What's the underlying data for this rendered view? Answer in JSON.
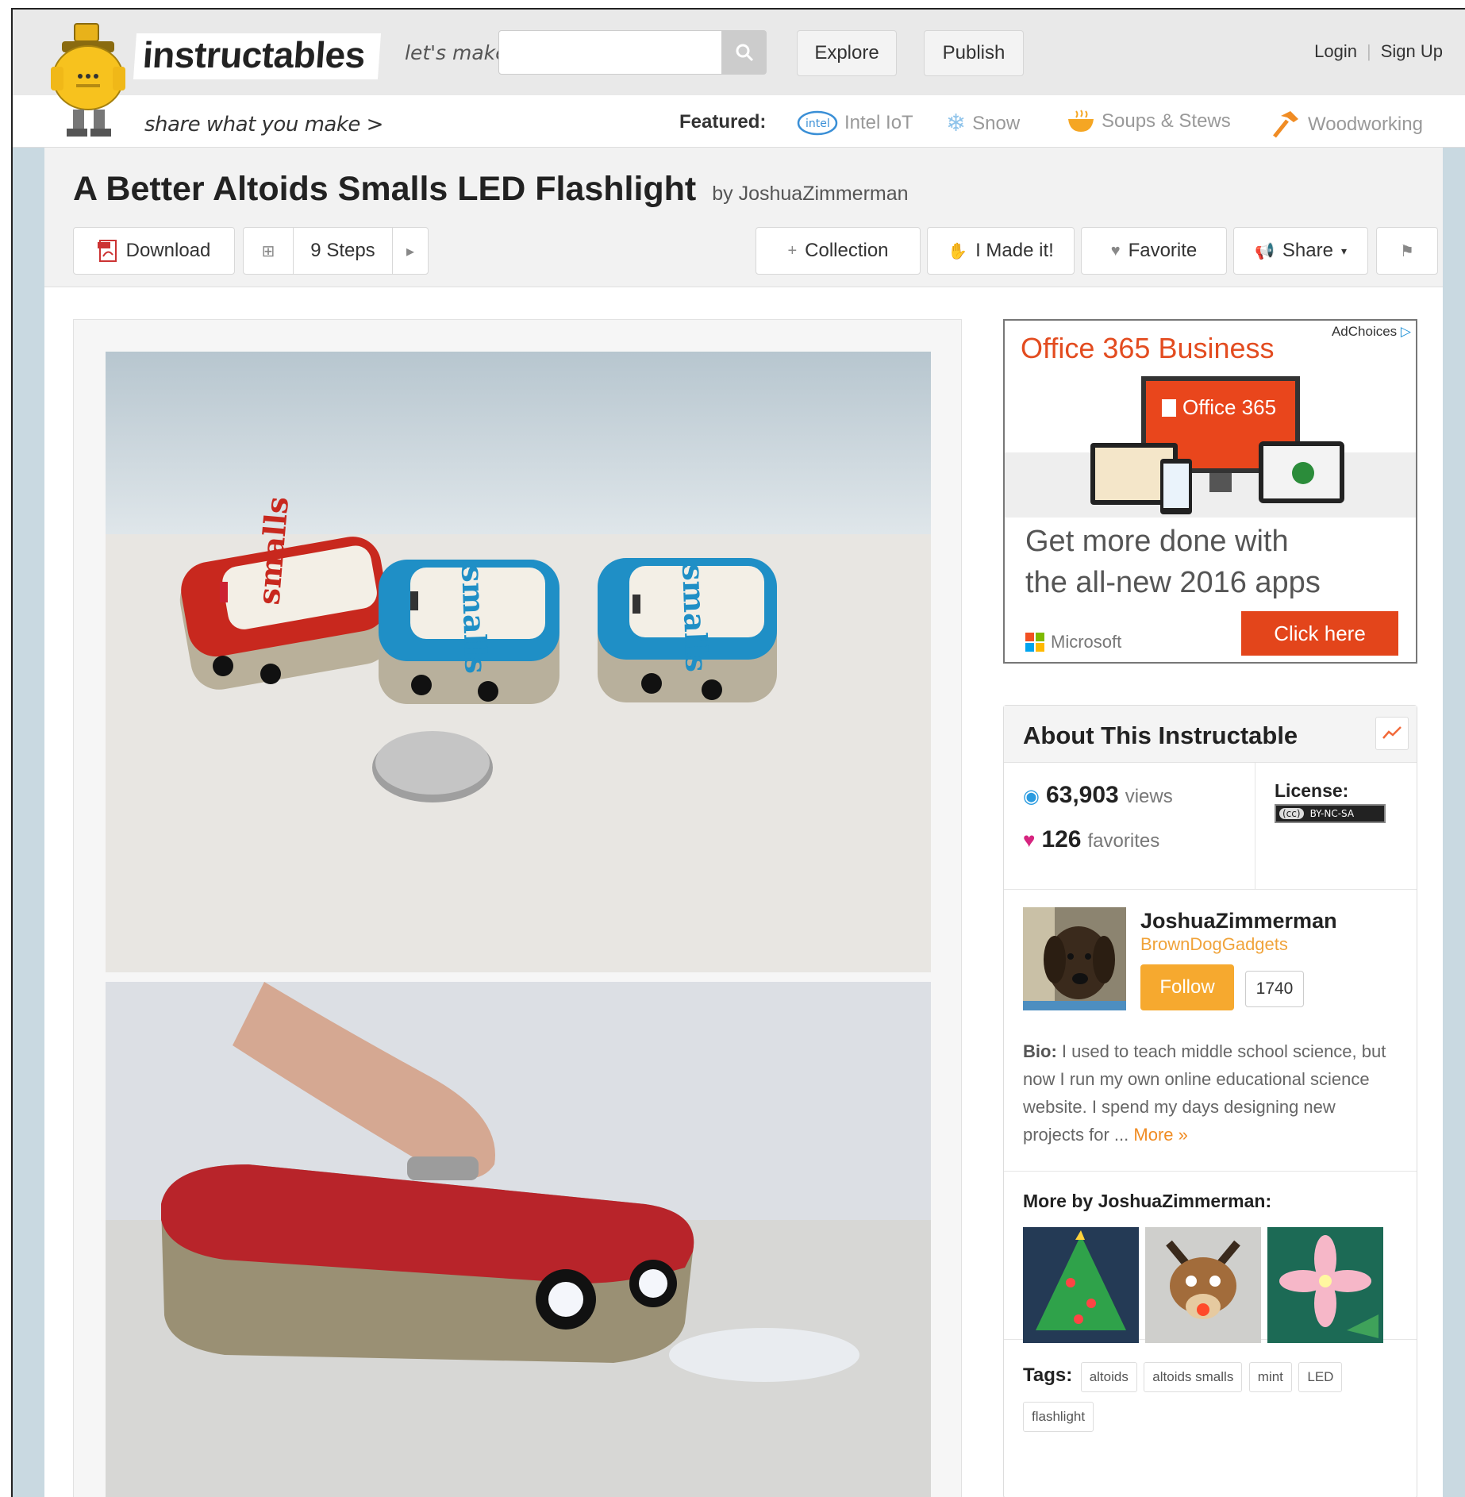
{
  "header": {
    "logo_text": "instructables",
    "tagline": "share what you make >",
    "lets_make_label": "let's make",
    "search_placeholder": "",
    "nav": {
      "explore": "Explore",
      "publish": "Publish",
      "login": "Login",
      "signup": "Sign Up",
      "separator": "|"
    },
    "featured": {
      "label": "Featured:",
      "items": [
        {
          "label": "Intel IoT",
          "icon": "intel-logo-icon"
        },
        {
          "label": "Snow",
          "icon": "snowflake-icon"
        },
        {
          "label": "Soups & Stews",
          "icon": "soup-bowl-icon"
        },
        {
          "label": "Woodworking",
          "icon": "hammer-icon"
        }
      ]
    }
  },
  "project": {
    "title": "A Better Altoids Smalls LED Flashlight",
    "by_prefix": "by",
    "author": "JoshuaZimmerman",
    "toolbar": {
      "download": "Download",
      "steps": "9 Steps",
      "collection": "Collection",
      "made_it": "I Made it!",
      "favorite": "Favorite",
      "share": "Share"
    }
  },
  "ad": {
    "title": "Office 365 Business",
    "adchoices": "AdChoices",
    "product_badge": "Office 365",
    "copy_line1": "Get more done with",
    "copy_line2": "the all-new 2016 apps",
    "brand": "Microsoft",
    "cta": "Click here"
  },
  "about": {
    "title": "About This Instructable",
    "views_count": "63,903",
    "views_label": "views",
    "favorites_count": "126",
    "favorites_label": "favorites",
    "license_label": "License:",
    "license_badge": "BY-NC-SA",
    "license_cc": "(cc)",
    "author_name": "JoshuaZimmerman",
    "author_team": "BrownDogGadgets",
    "follow": "Follow",
    "followers": "1740",
    "bio_label": "Bio:",
    "bio_text": "I used to teach middle school science, but now I run my own online educational science website. I spend my days designing new projects for ...",
    "bio_more": "More »",
    "more_by_title": "More by JoshuaZimmerman:",
    "tags_label": "Tags:",
    "tags": [
      "altoids",
      "altoids smalls",
      "mint",
      "LED",
      "flashlight"
    ]
  },
  "colors": {
    "accent_orange": "#f6a92f",
    "ad_red": "#e3451b",
    "header_bg": "#e9e9e9",
    "page_bg": "#c9d9e1"
  }
}
